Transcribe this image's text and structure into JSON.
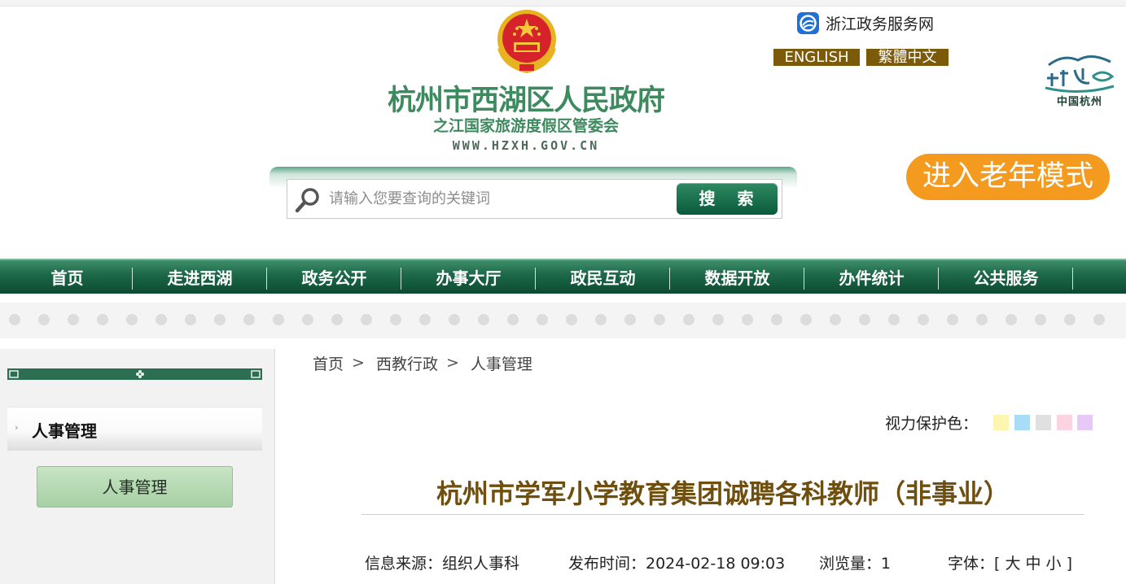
{
  "header": {
    "site_title": "杭州市西湖区人民政府",
    "site_subtitle": "之江国家旅游度假区管委会",
    "site_url": "WWW.HZXH.GOV.CN",
    "zj_link": "浙江政务服务网",
    "lang_en": "ENGLISH",
    "lang_tc": "繁體中文",
    "city_logo_text": "中国杭州",
    "elder_mode": "进入老年模式"
  },
  "search": {
    "placeholder": "请输入您要查询的关键词",
    "button": "搜 索"
  },
  "nav": [
    "首页",
    "走进西湖",
    "政务公开",
    "办事大厅",
    "政民互动",
    "数据开放",
    "办件统计",
    "公共服务"
  ],
  "sidebar": {
    "title": "人事管理",
    "item": "人事管理"
  },
  "breadcrumb": [
    "首页",
    "西教行政",
    "人事管理"
  ],
  "breadcrumb_sep": ">",
  "vision": {
    "label": "视力保护色：",
    "colors": [
      "#fdf6b0",
      "#a9dcf7",
      "#e0e0e0",
      "#fbd3e1",
      "#e6c9f6"
    ]
  },
  "article": {
    "title": "杭州市学军小学教育集团诚聘各科教师（非事业）",
    "source": "信息来源：组织人事科",
    "publish": "发布时间：2024-02-18 09:03",
    "views": "浏览量：1",
    "font": "字体：[ 大 中 小 ]"
  },
  "colors": {
    "nav_green": "#1e6a4a",
    "title_brown": "#6e4f10",
    "site_green": "#3d8a5f",
    "elder_orange": "#f39a1f",
    "lang_brown": "#7b5a0a"
  }
}
